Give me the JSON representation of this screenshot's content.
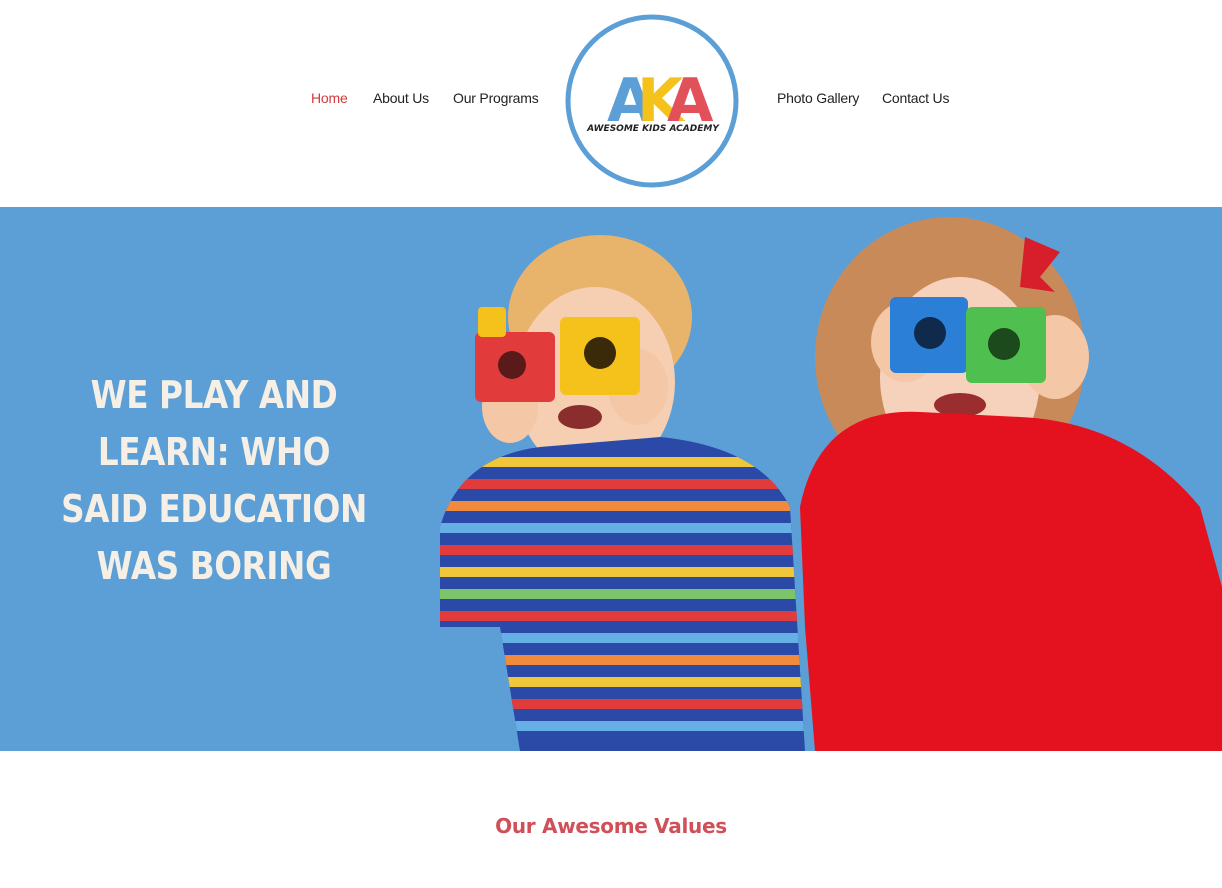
{
  "nav": {
    "left": [
      {
        "label": "Home",
        "active": true
      },
      {
        "label": "About Us",
        "active": false
      },
      {
        "label": "Our Programs",
        "active": false
      }
    ],
    "right": [
      {
        "label": "Photo Gallery",
        "active": false
      },
      {
        "label": "Contact Us",
        "active": false
      }
    ]
  },
  "logo": {
    "letters": [
      "A",
      "K",
      "A"
    ],
    "tagline": "AWESOME KIDS ACADEMY",
    "colors": {
      "ring": "#5b9fd6",
      "a1": "#5b9fd6",
      "k": "#f5c21b",
      "a2": "#e2505a"
    }
  },
  "hero": {
    "title": "WE PLAY AND LEARN: WHO SAID EDUCATION WAS BORING",
    "photo_icon": "kids-playing-with-blocks-photo",
    "background": "#5b9fd6"
  },
  "values": {
    "title": "Our Awesome Values"
  },
  "colors": {
    "accent_red": "#d23a3a",
    "values_title": "#d0505a",
    "hero_text": "#f5efe6"
  }
}
